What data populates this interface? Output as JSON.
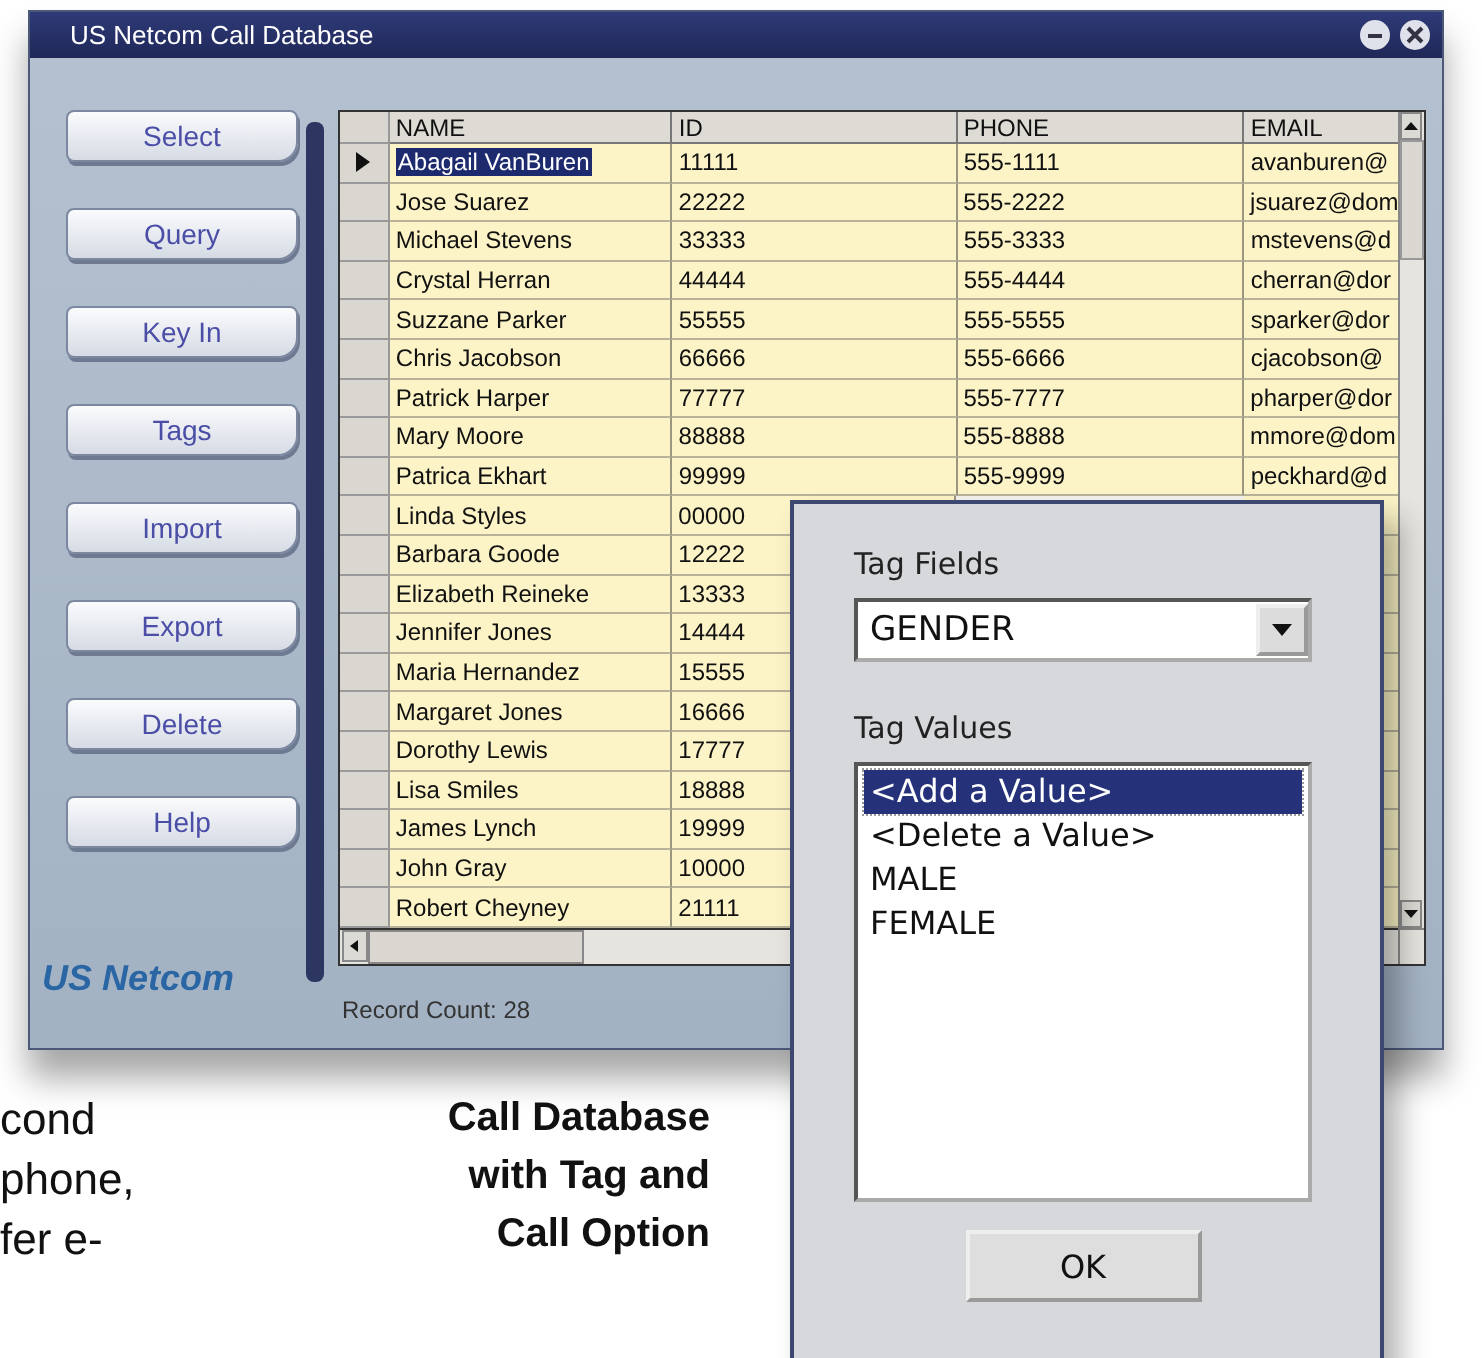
{
  "window": {
    "title": "US Netcom Call Database"
  },
  "side_buttons": [
    "Select",
    "Query",
    "Key In",
    "Tags",
    "Import",
    "Export",
    "Delete",
    "Help"
  ],
  "logo": "US Netcom",
  "grid": {
    "columns": [
      "NAME",
      "ID",
      "PHONE",
      "EMAIL"
    ],
    "rows": [
      {
        "selected": true,
        "name": "Abagail VanBuren",
        "id": "11111",
        "phone": "555-1111",
        "email": "avanburen@"
      },
      {
        "selected": false,
        "name": "Jose Suarez",
        "id": "22222",
        "phone": "555-2222",
        "email": "jsuarez@dom"
      },
      {
        "selected": false,
        "name": "Michael Stevens",
        "id": "33333",
        "phone": "555-3333",
        "email": "mstevens@d"
      },
      {
        "selected": false,
        "name": "Crystal Herran",
        "id": "44444",
        "phone": "555-4444",
        "email": "cherran@dor"
      },
      {
        "selected": false,
        "name": "Suzzane Parker",
        "id": "55555",
        "phone": "555-5555",
        "email": "sparker@dor"
      },
      {
        "selected": false,
        "name": "Chris Jacobson",
        "id": "66666",
        "phone": "555-6666",
        "email": "cjacobson@"
      },
      {
        "selected": false,
        "name": "Patrick Harper",
        "id": "77777",
        "phone": "555-7777",
        "email": "pharper@dor"
      },
      {
        "selected": false,
        "name": "Mary Moore",
        "id": "88888",
        "phone": "555-8888",
        "email": "mmore@dom"
      },
      {
        "selected": false,
        "name": "Patrica Ekhart",
        "id": "99999",
        "phone": "555-9999",
        "email": "peckhard@d"
      },
      {
        "selected": false,
        "name": "Linda Styles",
        "id": "00000"
      },
      {
        "selected": false,
        "name": "Barbara Goode",
        "id": "12222"
      },
      {
        "selected": false,
        "name": "Elizabeth Reineke",
        "id": "13333"
      },
      {
        "selected": false,
        "name": "Jennifer Jones",
        "id": "14444"
      },
      {
        "selected": false,
        "name": "Maria Hernandez",
        "id": "15555"
      },
      {
        "selected": false,
        "name": "Margaret Jones",
        "id": "16666"
      },
      {
        "selected": false,
        "name": "Dorothy Lewis",
        "id": "17777"
      },
      {
        "selected": false,
        "name": "Lisa Smiles",
        "id": "18888"
      },
      {
        "selected": false,
        "name": "James Lynch",
        "id": "19999"
      },
      {
        "selected": false,
        "name": "John Gray",
        "id": "10000"
      },
      {
        "selected": false,
        "name": "Robert Cheyney",
        "id": "21111"
      }
    ]
  },
  "record_count": "Record Count: 28",
  "tag_dialog": {
    "fields_label": "Tag Fields",
    "field_value": "GENDER",
    "values_label": "Tag Values",
    "values": [
      {
        "text": "<Add a Value>",
        "selected": true
      },
      {
        "text": "<Delete a Value>",
        "selected": false
      },
      {
        "text": "MALE",
        "selected": false
      },
      {
        "text": "FEMALE",
        "selected": false
      }
    ],
    "ok": "OK"
  },
  "page_text": {
    "fragments": [
      "cond",
      "phone,",
      "fer e-"
    ],
    "caption": [
      "Call Database",
      "with Tag and",
      "Call Option"
    ]
  }
}
